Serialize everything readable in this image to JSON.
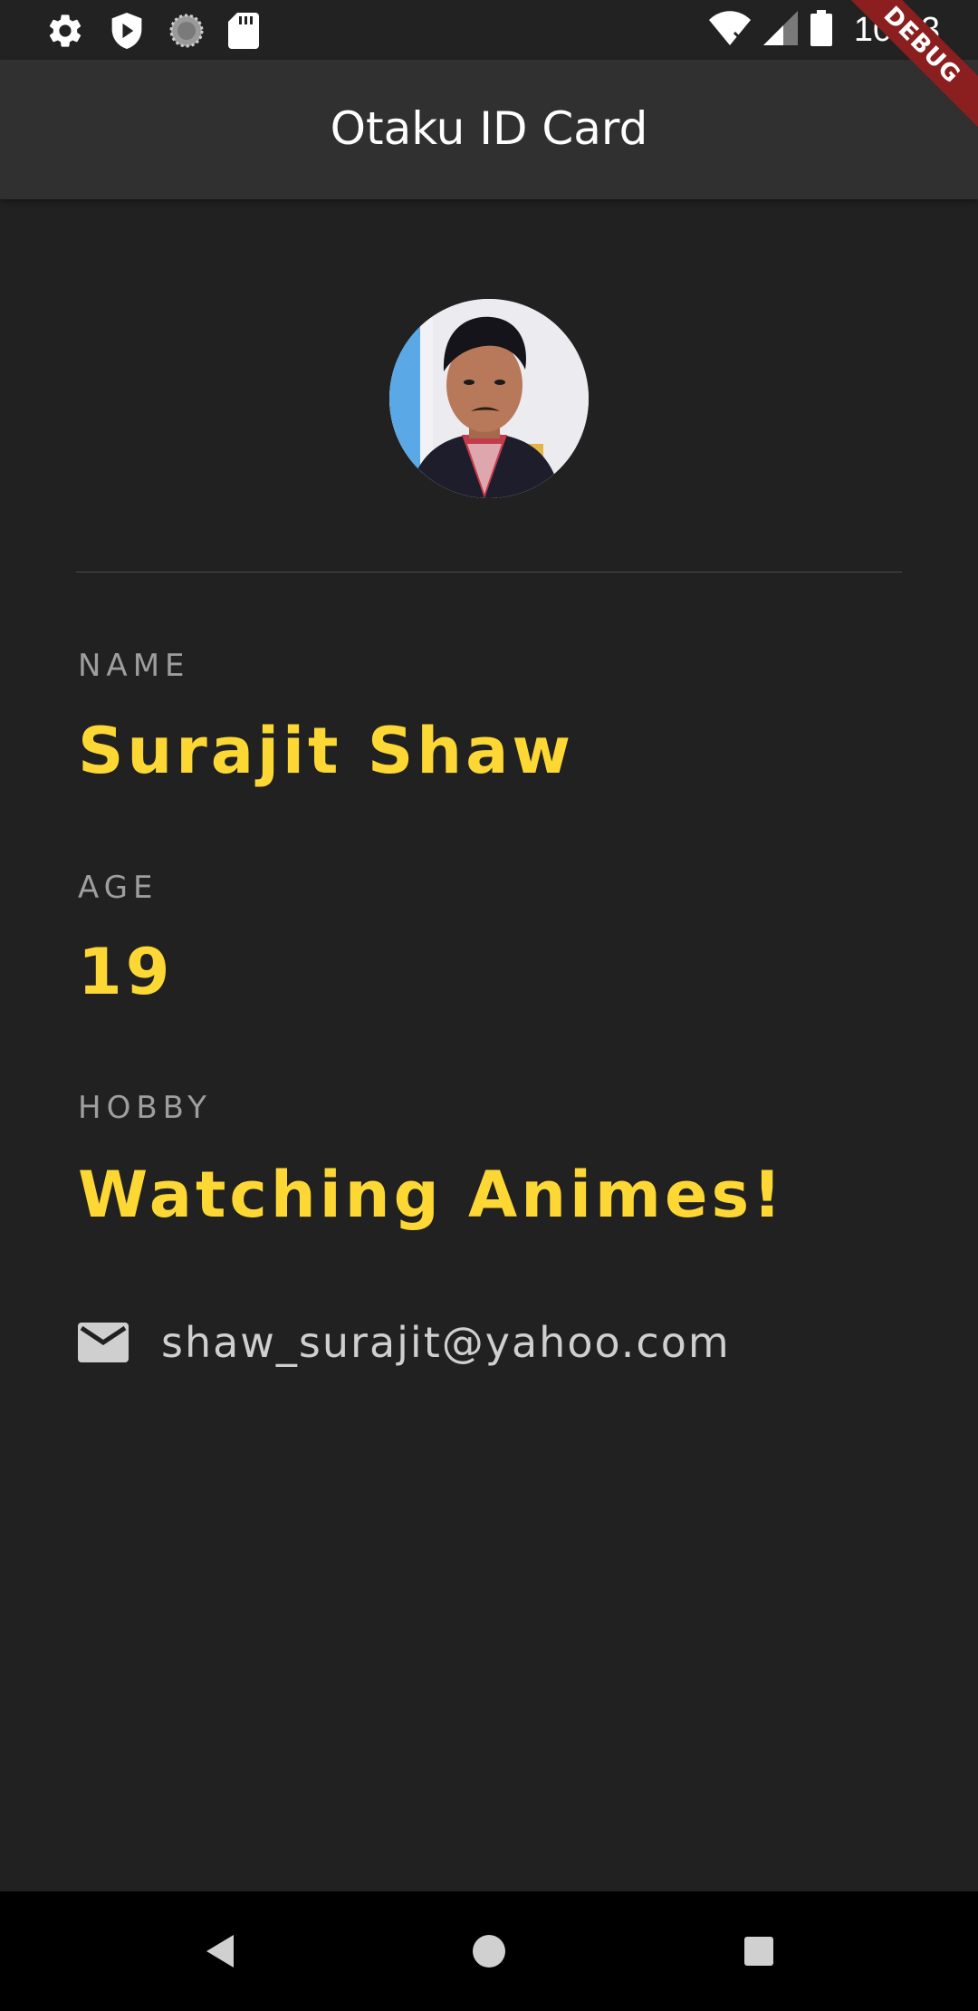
{
  "status_bar": {
    "time": "10:53",
    "left_icons": [
      "settings-icon",
      "shield-play-icon",
      "loading-circle-icon",
      "sd-card-icon"
    ],
    "right_icons": [
      "wifi-icon",
      "signal-icon",
      "battery-icon"
    ]
  },
  "app_bar": {
    "title": "Otaku ID Card"
  },
  "debug_banner": "DEBUG",
  "profile": {
    "avatar_icon": "profile-photo",
    "name_label": "NAME",
    "name_value": "Surajit Shaw",
    "age_label": "AGE",
    "age_value": "19",
    "hobby_label": "HOBBY",
    "hobby_value": "Watching Animes!",
    "email_icon": "email-icon",
    "email": "shaw_surajit@yahoo.com"
  },
  "nav_bar": {
    "buttons": [
      "back-icon",
      "home-icon",
      "recents-icon"
    ]
  },
  "colors": {
    "background": "#212121",
    "app_bar": "#303030",
    "accent": "#fdd835",
    "label": "#9e9e9e",
    "email_text": "#cfcfcf"
  }
}
